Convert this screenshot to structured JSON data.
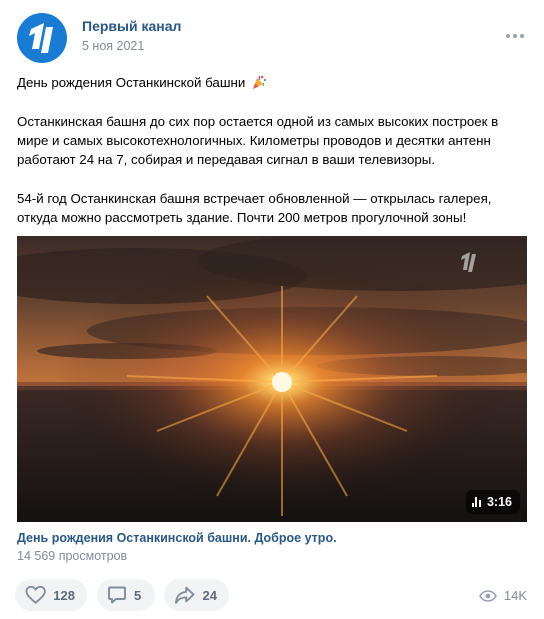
{
  "post": {
    "author": "Первый канал",
    "date": "5 ноя 2021",
    "title_line": "День рождения Останкинской башни",
    "paragraph1": "Останкинская башня до сих пор остается одной из самых высоких построек в мире и самых высокотехнологичных. Километры проводов и десятки антенн работают 24 на 7, собирая и передавая сигнал в ваши телевизоры.",
    "paragraph2": "54-й год Останкинская башня встречает обновленной — открылась галерея, откуда можно рассмотреть здание. Почти 200 метров прогулочной зоны!"
  },
  "video": {
    "duration": "3:16",
    "title": "День рождения Останкинской башни. Доброе утро.",
    "views": "14 569 просмотров"
  },
  "actions": {
    "likes": "128",
    "comments": "5",
    "shares": "24",
    "views": "14K"
  },
  "icons": {
    "avatar": "channel-one-logo",
    "title_emoji": "party-popper-icon",
    "more": "more-dots-icon",
    "duration": "bars-icon",
    "like": "heart-icon",
    "comment": "comment-icon",
    "share": "share-arrow-icon",
    "views": "eye-icon"
  },
  "colors": {
    "link": "#2a5885",
    "secondary": "#818c99",
    "button_bg": "#f2f3f5",
    "avatar_bg": "#1a7bd3"
  }
}
